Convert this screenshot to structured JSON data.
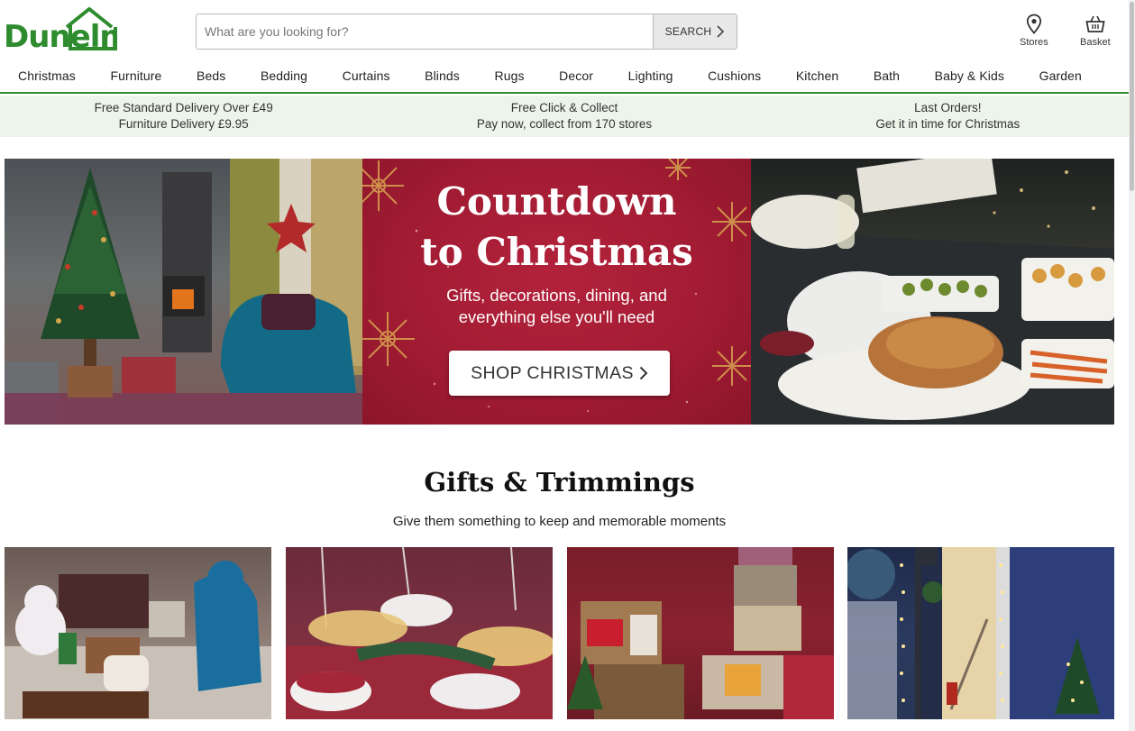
{
  "brand": {
    "name": "Dunelm",
    "color": "#2e8b2e"
  },
  "search": {
    "placeholder": "What are you looking for?",
    "button_label": "SEARCH"
  },
  "header_links": {
    "stores": "Stores",
    "basket": "Basket"
  },
  "nav": [
    "Christmas",
    "Furniture",
    "Beds",
    "Bedding",
    "Curtains",
    "Blinds",
    "Rugs",
    "Decor",
    "Lighting",
    "Cushions",
    "Kitchen",
    "Bath",
    "Baby & Kids",
    "Garden"
  ],
  "usp": [
    {
      "line1": "Free Standard Delivery Over £49",
      "line2": "Furniture Delivery £9.95"
    },
    {
      "line1": "Free Click & Collect",
      "line2": "Pay now, collect from 170 stores"
    },
    {
      "line1": "Last Orders!",
      "line2": "Get it in time for Christmas"
    }
  ],
  "hero": {
    "title_line1": "Countdown",
    "title_line2": "to Christmas",
    "sub_line1": "Gifts, decorations, dining, and",
    "sub_line2": "everything else you'll need",
    "button_label": "SHOP CHRISTMAS"
  },
  "section": {
    "title": "Gifts & Trimmings",
    "subtitle": "Give them something to keep and memorable moments"
  },
  "tiles": [
    "toys-gifts-photo",
    "dining-table-photo",
    "hampers-photo",
    "front-door-lights-photo"
  ]
}
